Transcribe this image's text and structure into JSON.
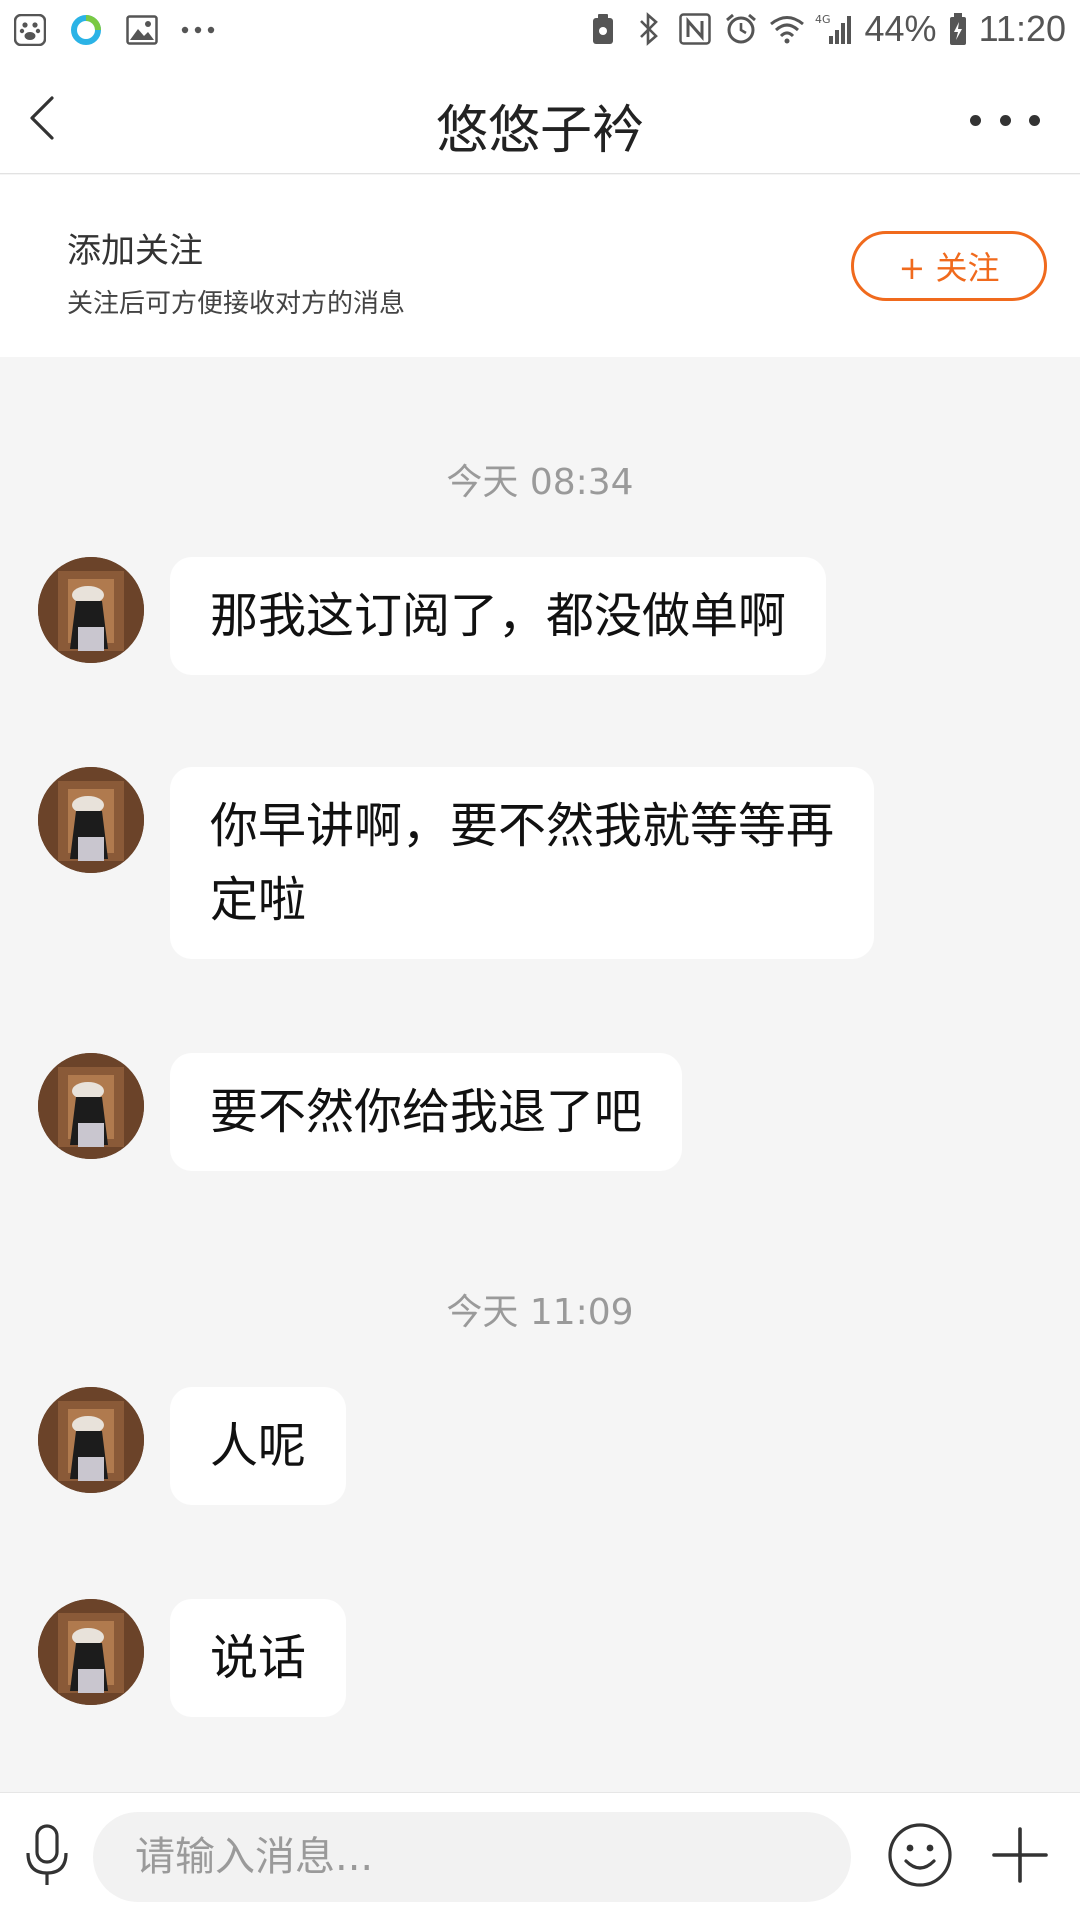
{
  "status_bar": {
    "left_icons": [
      "baidu-paw-icon",
      "sync-app-icon",
      "gallery-icon",
      "more-dots-icon"
    ],
    "right_icons": [
      "nfc-icon",
      "bluetooth-icon",
      "nfc-n-icon",
      "alarm-icon",
      "wifi-icon",
      "cell-signal-icon",
      "battery-icon"
    ],
    "network": "4G",
    "battery_percent": "44%",
    "time": "11:20"
  },
  "header": {
    "title": "悠悠子衿",
    "back_icon": "chevron-left-icon",
    "more_icon": "more-horizontal-icon"
  },
  "follow_banner": {
    "title": "添加关注",
    "subtitle": "关注后可方便接收对方的消息",
    "button_label": "+ 关注",
    "accent_color": "#f06a1d"
  },
  "conversation": {
    "groups": [
      {
        "timestamp": "今天 08:34",
        "messages": [
          {
            "text": "那我这订阅了，都没做单啊"
          },
          {
            "text": "你早讲啊，要不然我就等等再定啦"
          },
          {
            "text": "要不然你给我退了吧"
          }
        ]
      },
      {
        "timestamp": "今天 11:09",
        "messages": [
          {
            "text": "人呢"
          },
          {
            "text": "说话"
          }
        ]
      }
    ]
  },
  "input_bar": {
    "placeholder": "请输入消息...",
    "mic_icon": "microphone-icon",
    "emoji_icon": "emoji-icon",
    "plus_icon": "plus-icon"
  }
}
